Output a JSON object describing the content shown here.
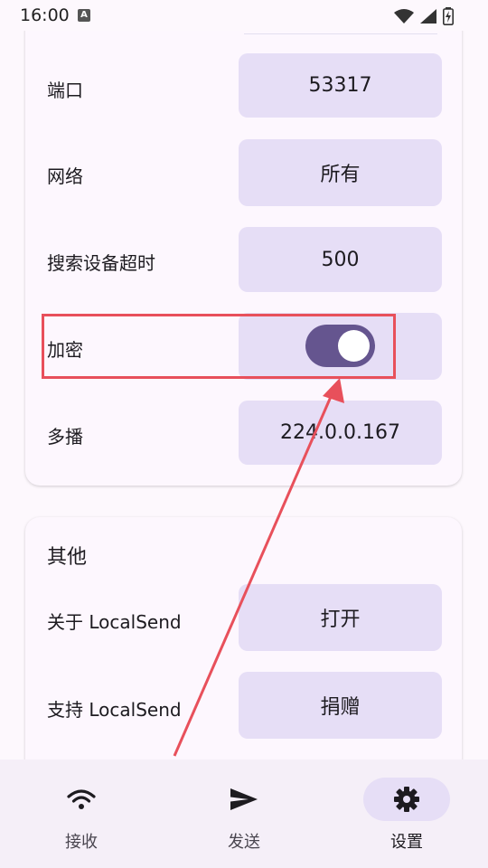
{
  "status_bar": {
    "time": "16:00",
    "notification_icon": "A"
  },
  "network": {
    "port_label": "端口",
    "port_value": "53317",
    "network_label": "网络",
    "network_value": "所有",
    "timeout_label": "搜索设备超时",
    "timeout_value": "500",
    "encryption_label": "加密",
    "encryption_enabled": true,
    "multicast_label": "多播",
    "multicast_value": "224.0.0.167"
  },
  "other": {
    "title": "其他",
    "about_label": "关于 LocalSend",
    "about_button": "打开",
    "support_label": "支持 LocalSend",
    "support_button": "捐赠"
  },
  "bottom_nav": {
    "receive_label": "接收",
    "send_label": "发送",
    "settings_label": "设置",
    "active": "settings"
  },
  "colors": {
    "accent": "#65558f",
    "button_bg": "#e6def6",
    "highlight": "#e8505b"
  }
}
